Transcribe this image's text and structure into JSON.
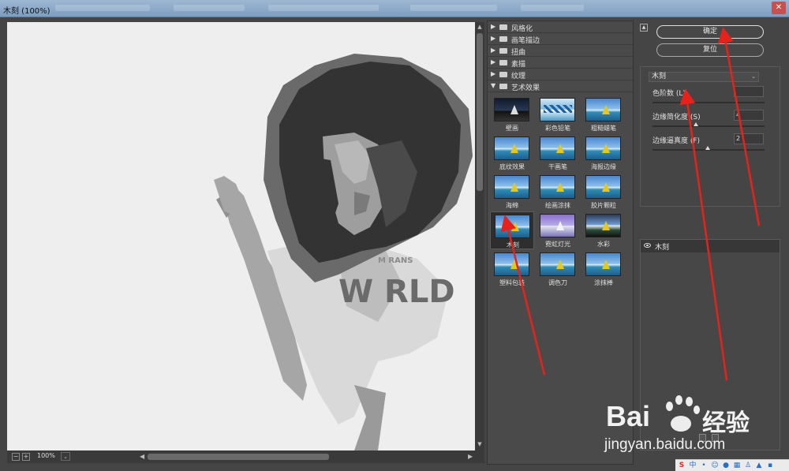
{
  "window": {
    "title": "木刻 (100%)"
  },
  "preview": {
    "zoom": "100%",
    "zoom_out": "−",
    "zoom_in": "+",
    "shirt_text": "W RLD",
    "shirt_text_small": "M RANS"
  },
  "gallery": {
    "folders": [
      {
        "label": "风格化",
        "expanded": false
      },
      {
        "label": "画笔描边",
        "expanded": false
      },
      {
        "label": "扭曲",
        "expanded": false
      },
      {
        "label": "素描",
        "expanded": false
      },
      {
        "label": "纹理",
        "expanded": false
      },
      {
        "label": "艺术效果",
        "expanded": true
      }
    ],
    "filters": [
      {
        "label": "壁画",
        "style": "dark"
      },
      {
        "label": "彩色铅笔",
        "style": "zig"
      },
      {
        "label": "粗糙蜡笔",
        "style": "normal"
      },
      {
        "label": "底纹效果",
        "style": "normal"
      },
      {
        "label": "干画笔",
        "style": "normal"
      },
      {
        "label": "海报边缘",
        "style": "normal"
      },
      {
        "label": "海绵",
        "style": "normal"
      },
      {
        "label": "绘画涂抹",
        "style": "normal"
      },
      {
        "label": "胶片颗粒",
        "style": "normal"
      },
      {
        "label": "木刻",
        "style": "normal",
        "selected": true
      },
      {
        "label": "霓虹灯光",
        "style": "neon"
      },
      {
        "label": "水彩",
        "style": "wc"
      },
      {
        "label": "塑料包装",
        "style": "normal"
      },
      {
        "label": "调色刀",
        "style": "normal"
      },
      {
        "label": "涂抹棒",
        "style": "normal"
      }
    ]
  },
  "panel": {
    "ok_label": "确定",
    "reset_label": "复位",
    "selected_filter": "木刻",
    "params": [
      {
        "label": "色阶数 (L)",
        "value": "",
        "fraction": 0.33
      },
      {
        "label": "边缘简化度 (S)",
        "value": "4",
        "fraction": 0.39
      },
      {
        "label": "边缘逼真度 (F)",
        "value": "2",
        "fraction": 0.49
      }
    ],
    "layer_name": "木刻"
  },
  "watermark": {
    "brand_left": "Bai",
    "brand_right": "经验",
    "url": "jingyan.baidu.com"
  },
  "tray": {
    "ime": "中",
    "punct": "•"
  },
  "colors": {
    "arrow": "#e8221b",
    "panel_bg": "#454545",
    "preview_bg": "#eeeeee"
  }
}
